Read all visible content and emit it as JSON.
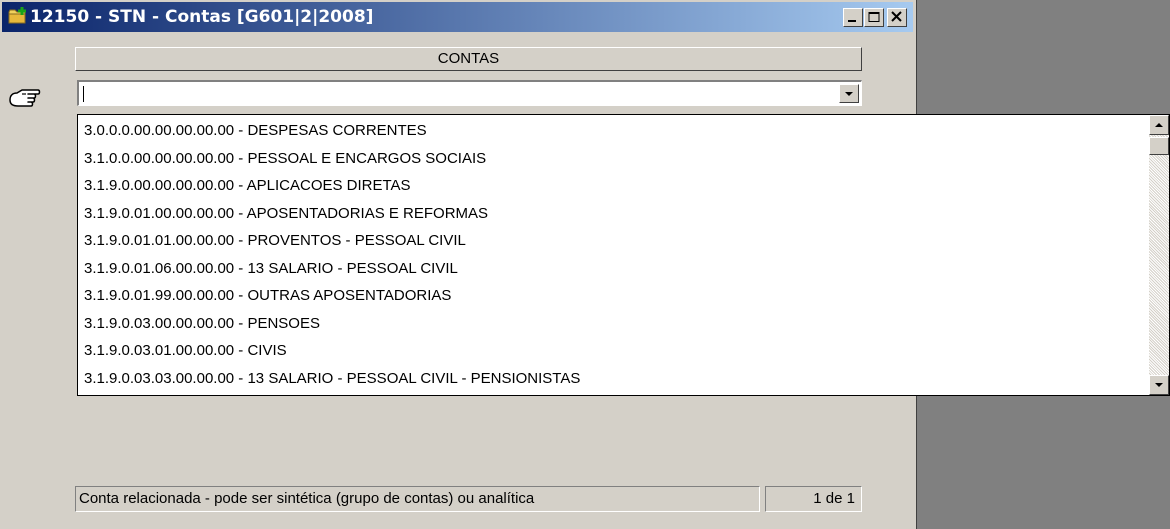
{
  "window": {
    "title": "12150 - STN - Contas [G601|2|2008]",
    "icon": "new-folder-icon"
  },
  "titlebar_buttons": {
    "minimize": "minimize-icon",
    "restore": "restore-icon",
    "close": "close-icon"
  },
  "header": {
    "label": "CONTAS"
  },
  "combo": {
    "value": "",
    "dropdown_icon": "chevron-down-icon"
  },
  "pointer_icon": "pointing-hand-icon",
  "dropdown": {
    "items": [
      "3.0.0.0.00.00.00.00.00 - DESPESAS CORRENTES",
      "3.1.0.0.00.00.00.00.00 - PESSOAL E ENCARGOS SOCIAIS",
      "3.1.9.0.00.00.00.00.00 - APLICACOES DIRETAS",
      "3.1.9.0.01.00.00.00.00 - APOSENTADORIAS E REFORMAS",
      "3.1.9.0.01.01.00.00.00 - PROVENTOS - PESSOAL CIVIL",
      "3.1.9.0.01.06.00.00.00 - 13 SALARIO - PESSOAL CIVIL",
      "3.1.9.0.01.99.00.00.00 - OUTRAS APOSENTADORIAS",
      "3.1.9.0.03.00.00.00.00 - PENSOES",
      "3.1.9.0.03.01.00.00.00 - CIVIS",
      "3.1.9.0.03.03.00.00.00 - 13 SALARIO - PESSOAL CIVIL - PENSIONISTAS"
    ]
  },
  "statusbar": {
    "message": "Conta relacionada - pode ser sintética (grupo de contas) ou analítica",
    "page": "1 de 1"
  },
  "colors": {
    "titlebar_start": "#0a246a",
    "titlebar_end": "#a6caf0",
    "face": "#d4d0c8",
    "desktop": "#808080"
  }
}
